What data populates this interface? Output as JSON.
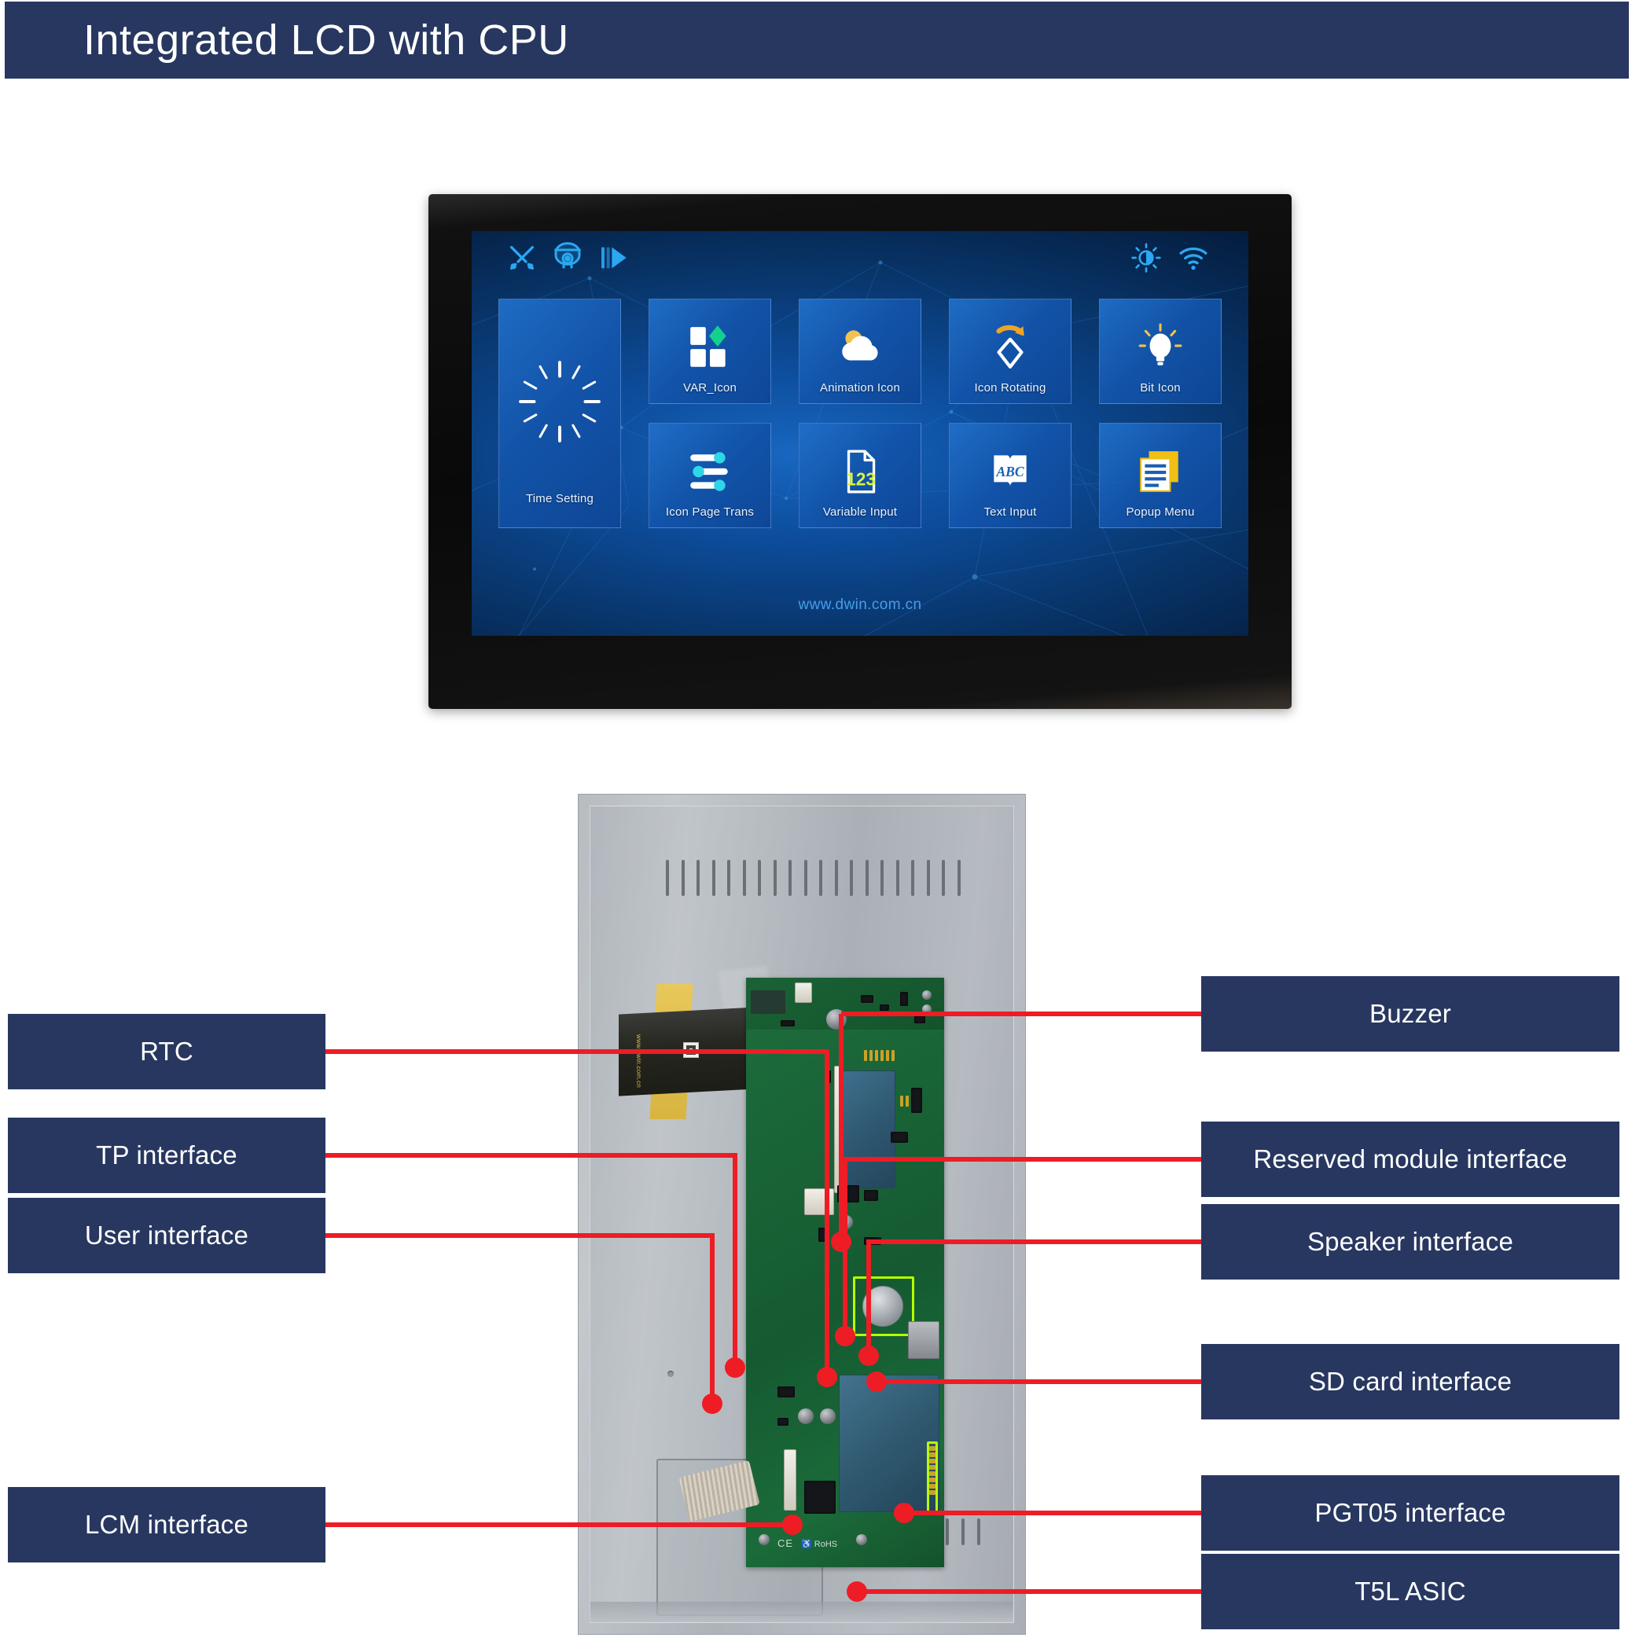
{
  "banner": {
    "title": "Integrated LCD with CPU"
  },
  "screen": {
    "watermark": "www.dwin.com.cn",
    "status_icons": [
      {
        "name": "tools-icon",
        "label": "Tools"
      },
      {
        "name": "dome-camera-icon",
        "label": "Camera"
      },
      {
        "name": "play-next-icon",
        "label": "Play"
      },
      {
        "name": "brightness-icon",
        "label": "Brightness"
      },
      {
        "name": "wifi-icon",
        "label": "WiFi"
      }
    ],
    "tiles": [
      {
        "label": "Time Setting",
        "icon": "clock-icon"
      },
      {
        "label": "VAR_Icon",
        "icon": "squares-diamond-icon"
      },
      {
        "label": "Animation Icon",
        "icon": "cloud-sun-icon"
      },
      {
        "label": "Icon Rotating",
        "icon": "rotating-diamond-icon"
      },
      {
        "label": "Bit Icon",
        "icon": "lightbulb-icon"
      },
      {
        "label": "Icon Page Trans",
        "icon": "sliders-icon"
      },
      {
        "label": "Variable Input",
        "icon": "numeric-page-icon"
      },
      {
        "label": "Text Input",
        "icon": "abc-book-icon"
      },
      {
        "label": "Popup Menu",
        "icon": "popup-list-icon"
      }
    ]
  },
  "callouts": {
    "left": [
      {
        "label": "RTC"
      },
      {
        "label": "TP interface"
      },
      {
        "label": "User interface"
      },
      {
        "label": "LCM interface"
      }
    ],
    "right": [
      {
        "label": "Buzzer"
      },
      {
        "label": "Reserved module interface"
      },
      {
        "label": "Speaker interface"
      },
      {
        "label": "SD card interface"
      },
      {
        "label": "PGT05 interface"
      },
      {
        "label": "T5L ASIC"
      }
    ]
  },
  "colors": {
    "banner_navy": "#27375f",
    "label_navy": "#27375f",
    "callout_red": "#ee1c25",
    "highlight_green": "#b6ff00",
    "screen_blue": "#0d4e9e",
    "accent_cyan": "#2aa8f2"
  }
}
